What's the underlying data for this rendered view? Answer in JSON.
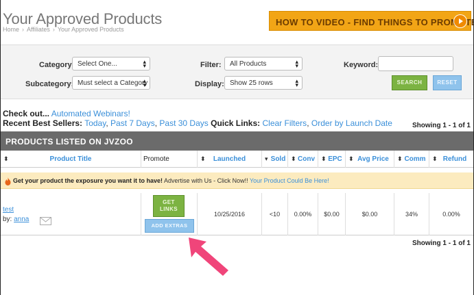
{
  "header": {
    "title": "Your Approved Products",
    "breadcrumb": [
      "Home",
      "Affiliates",
      "Your Approved Products"
    ],
    "howto_button": "HOW TO VIDEO - FIND THINGS TO PROMOTE!"
  },
  "filters": {
    "category_label": "Category:",
    "category_value": "Select One...",
    "subcategory_label": "Subcategory:",
    "subcategory_value": "Must select a Category al",
    "filter_label": "Filter:",
    "filter_value": "All Products",
    "display_label": "Display:",
    "display_value": "Show 25 rows",
    "keyword_label": "Keyword:",
    "keyword_value": "",
    "search_button": "SEARCH",
    "reset_button": "RESET"
  },
  "checkout": {
    "prefix": "Check out...",
    "link": "Automated Webinars!"
  },
  "recent": {
    "label": "Recent Best Sellers:",
    "today": "Today",
    "past7": "Past 7 Days",
    "past30": "Past 30 Days",
    "quick_label": "Quick Links:",
    "clear": "Clear Filters",
    "order": "Order by Launch Date",
    "sep": ","
  },
  "showing": "Showing 1 - 1 of 1",
  "products": {
    "section_title": "PRODUCTS LISTED ON JVZOO",
    "columns": {
      "title": "Product Title",
      "promote": "Promote",
      "launched": "Launched",
      "sold": "Sold",
      "conv": "Conv",
      "epc": "EPC",
      "avg_price": "Avg Price",
      "comm": "Comm",
      "refund": "Refund"
    },
    "promo": {
      "bold": "Get your product the exposure you want it to have!",
      "normal": "Advertise with Us - Click Now!!",
      "link": "Your Product Could Be Here!"
    },
    "rows": [
      {
        "name": "test",
        "by_label": "by:",
        "author": "anna",
        "get_links": "GET LINKS",
        "add_extras": "ADD EXTRAS",
        "launched": "10/25/2016",
        "sold": "<10",
        "conv": "0.00%",
        "epc": "$0.00",
        "avg_price": "$0.00",
        "comm": "34%",
        "refund": "0.00%"
      }
    ]
  },
  "colors": {
    "howto_bg": "#f2a516",
    "header_bar": "#6b6b6b",
    "promo_bg": "#fcebbf",
    "green_button": "#7cb342",
    "blue_button": "#8fc3ec",
    "link": "#3a8fd9",
    "annotation_arrow": "#f0457a"
  }
}
